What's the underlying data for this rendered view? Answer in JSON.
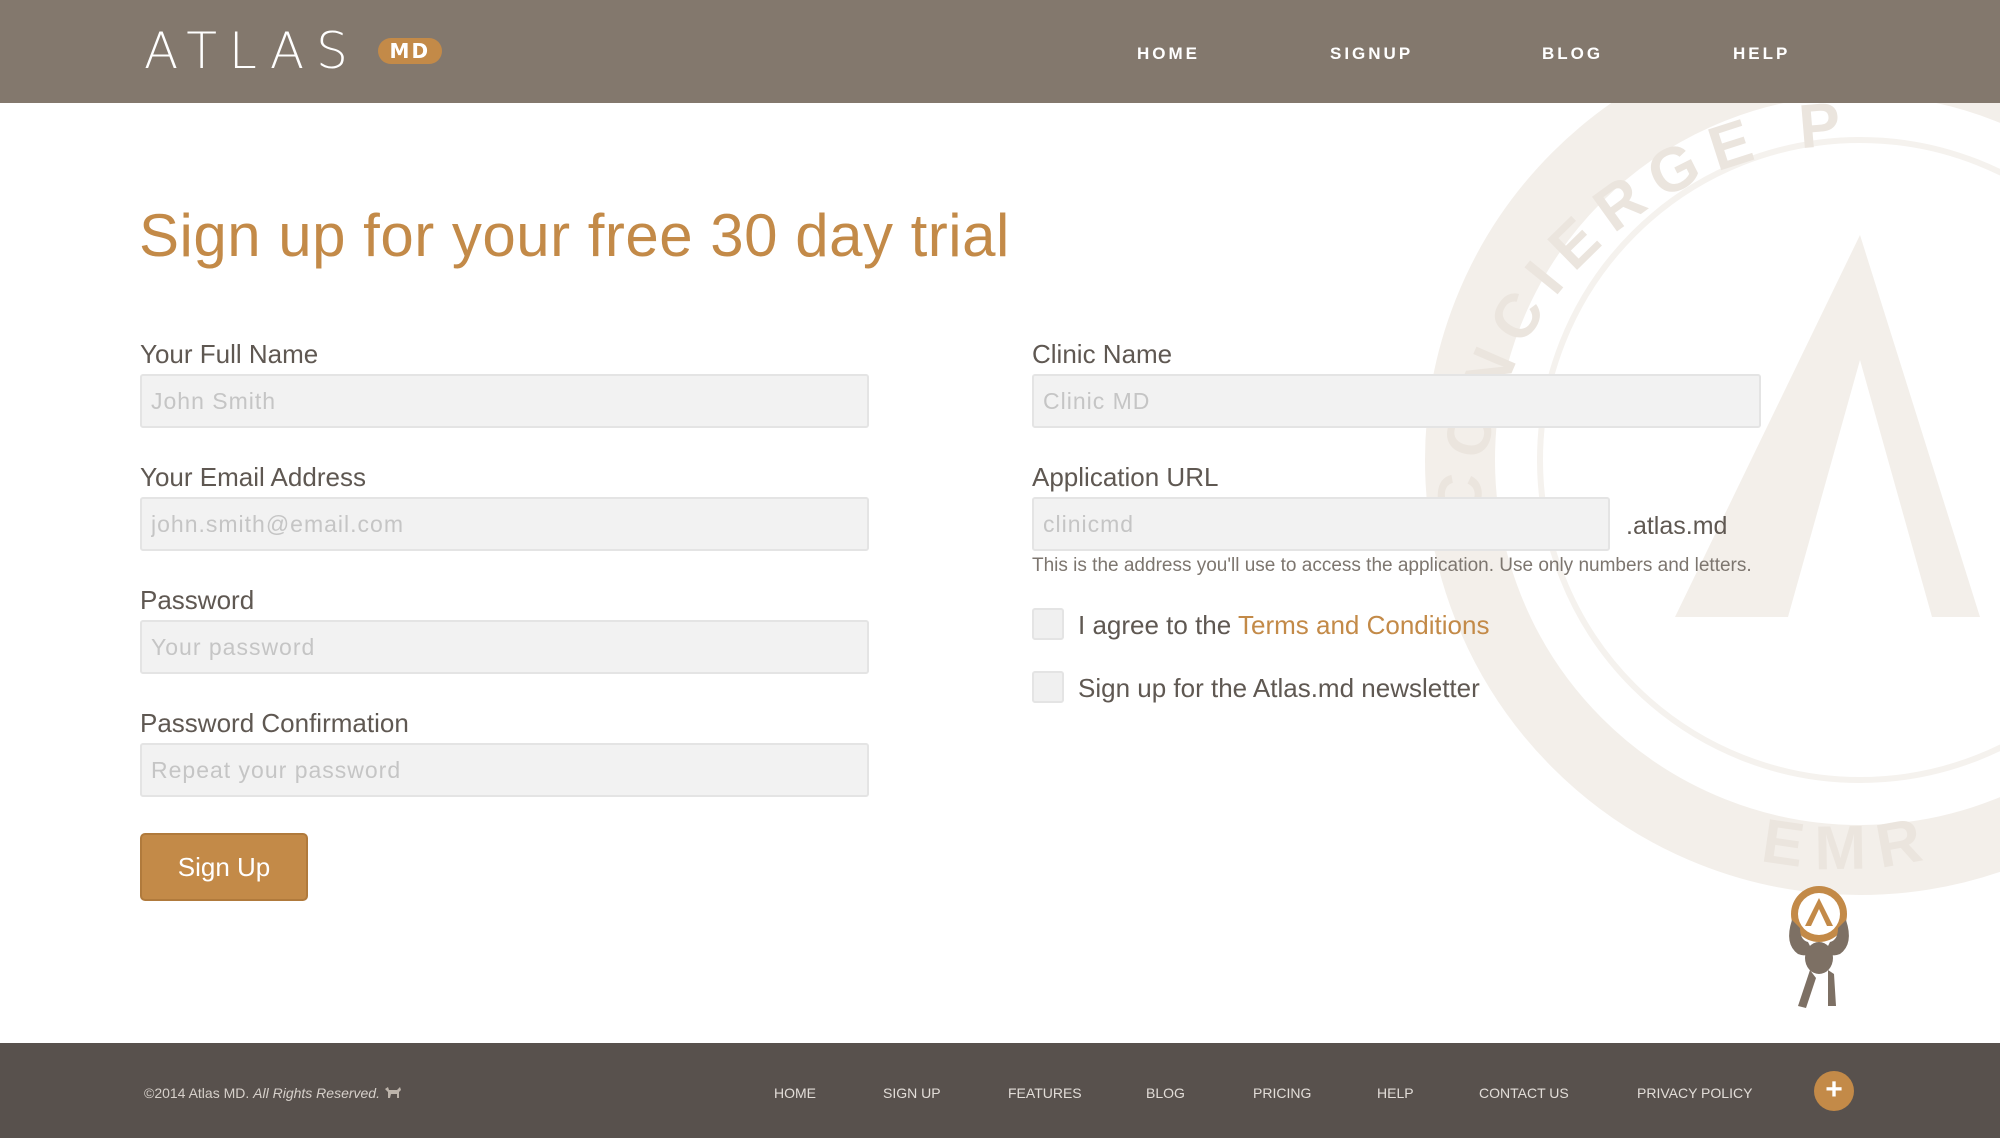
{
  "header": {
    "logo_text": "ATLAS",
    "logo_badge": "MD",
    "nav": [
      {
        "label": "HOME"
      },
      {
        "label": "SIGNUP"
      },
      {
        "label": "BLOG"
      },
      {
        "label": "HELP"
      }
    ]
  },
  "seal": {
    "text_top": "CONCIERGE P",
    "text_bottom": "EMR"
  },
  "form": {
    "title": "Sign up for your free 30 day trial",
    "full_name": {
      "label": "Your Full Name",
      "placeholder": "John Smith",
      "value": ""
    },
    "email": {
      "label": "Your Email Address",
      "placeholder": "john.smith@email.com",
      "value": ""
    },
    "password": {
      "label": "Password",
      "placeholder": "Your password",
      "value": ""
    },
    "password_confirmation": {
      "label": "Password Confirmation",
      "placeholder": "Repeat your password",
      "value": ""
    },
    "clinic_name": {
      "label": "Clinic Name",
      "placeholder": "Clinic MD",
      "value": ""
    },
    "application_url": {
      "label": "Application URL",
      "placeholder": "clinicmd",
      "value": "",
      "suffix": ".atlas.md",
      "help": "This is the address you'll use to access the application. Use only numbers and letters."
    },
    "terms": {
      "prefix": "I agree to the ",
      "link": "Terms and Conditions",
      "checked": false
    },
    "newsletter": {
      "label": "Sign up for the Atlas.md newsletter",
      "checked": false
    },
    "submit_label": "Sign Up"
  },
  "footer": {
    "copyright": "©2014 Atlas MD.",
    "rights": "All Rights Reserved.",
    "nav": [
      {
        "label": "HOME"
      },
      {
        "label": "SIGN UP"
      },
      {
        "label": "FEATURES"
      },
      {
        "label": "BLOG"
      },
      {
        "label": "PRICING"
      },
      {
        "label": "HELP"
      },
      {
        "label": "CONTACT US"
      },
      {
        "label": "PRIVACY POLICY"
      }
    ],
    "plus_icon": "+"
  },
  "colors": {
    "header_bg": "#83786d",
    "accent": "#c38a48",
    "footer_bg": "#58514d",
    "input_bg": "#f2f2f2"
  }
}
